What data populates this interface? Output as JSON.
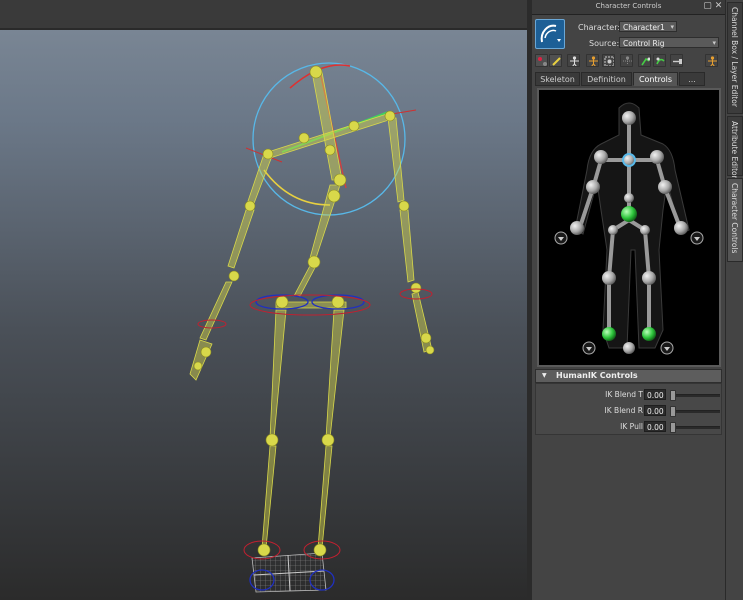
{
  "window": {
    "title": "Character Controls"
  },
  "character": {
    "label": "Character:",
    "value": "Character1"
  },
  "source": {
    "label": "Source:",
    "value": "Control Rig"
  },
  "tabs": [
    {
      "label": "Skeleton"
    },
    {
      "label": "Definition"
    },
    {
      "label": "Controls"
    },
    {
      "label": "..."
    }
  ],
  "hik_controls": {
    "title": "HumanIK Controls",
    "rows": [
      {
        "label": "IK Blend T",
        "value": "0.00"
      },
      {
        "label": "IK Blend R",
        "value": "0.00"
      },
      {
        "label": "IK Pull",
        "value": "0.00"
      }
    ]
  },
  "side_tabs": [
    {
      "label": "Channel Box / Layer Editor"
    },
    {
      "label": "Attribute Editor"
    },
    {
      "label": "Character Controls"
    }
  ],
  "colors": {
    "rig": "#d8d84a",
    "selected_effector": "#2cc43a",
    "panel_bg": "#444444",
    "accent": "#1d5f96"
  },
  "icons": {
    "logo": "humanik-logo-icon",
    "toolbar": [
      "select-all-icon",
      "pencil-icon",
      "full-body-icon",
      "body-part-icon",
      "selection-icon",
      "pin-translation-icon",
      "pin-rotation-icon",
      "release-pin-icon",
      "key-icon"
    ]
  }
}
